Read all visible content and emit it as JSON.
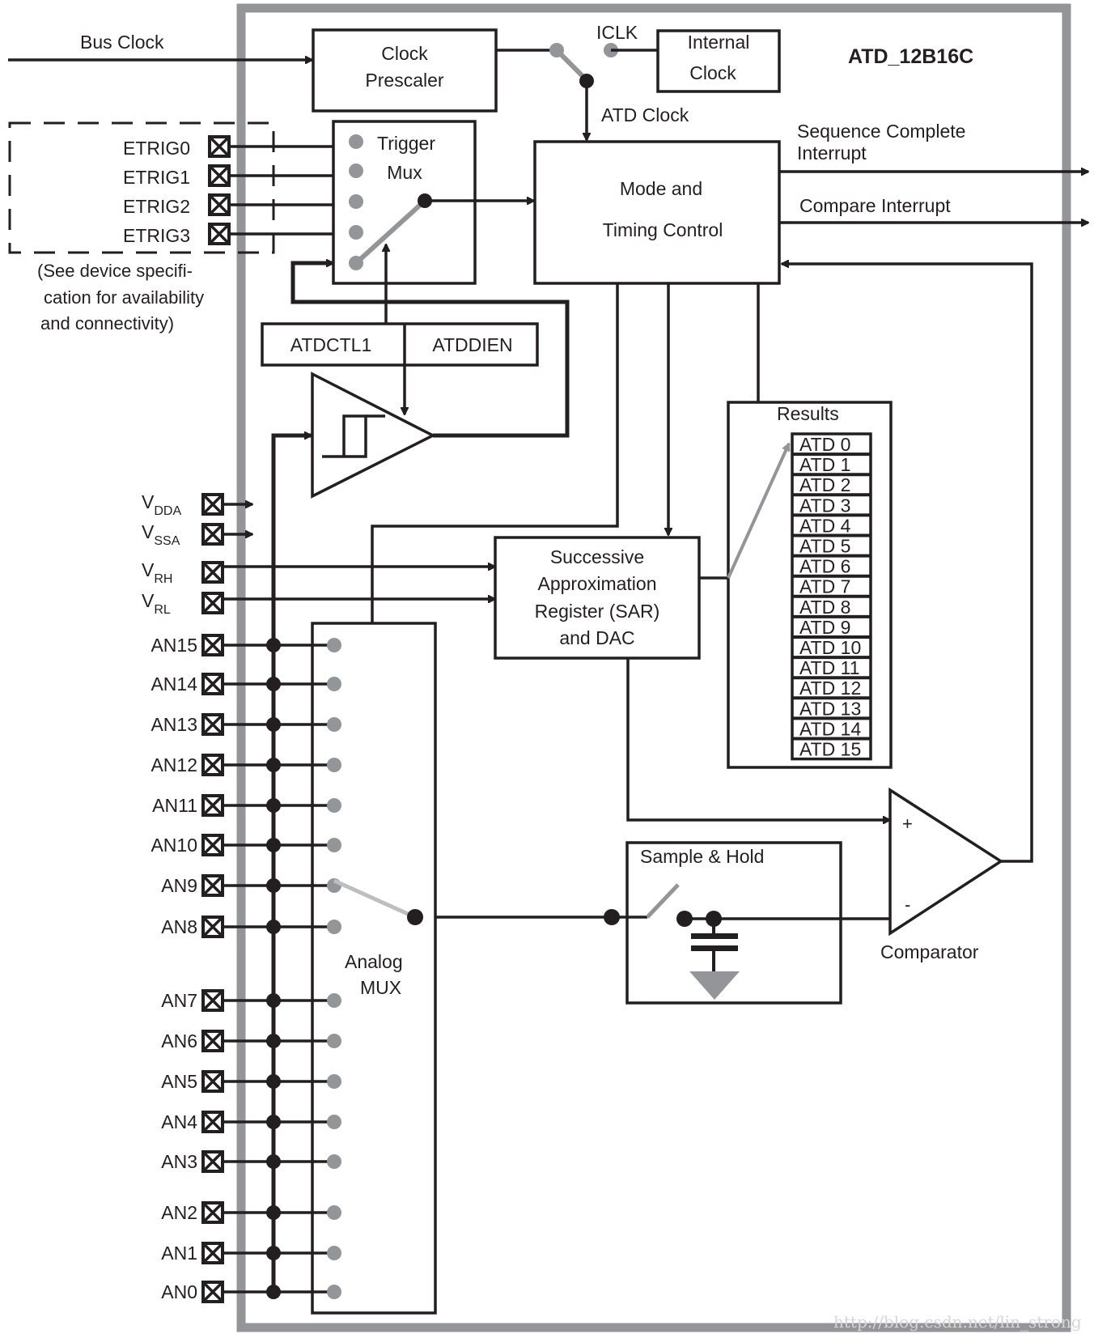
{
  "title": "ATD_12B16C",
  "external_inputs": {
    "bus_clock": "Bus Clock",
    "etrig": [
      "ETRIG0",
      "ETRIG1",
      "ETRIG2",
      "ETRIG3"
    ],
    "etrig_note": [
      "(See device specifi-",
      "cation for availability",
      "and connectivity)"
    ]
  },
  "blocks": {
    "clock_prescaler": [
      "Clock",
      "Prescaler"
    ],
    "iclk": "ICLK",
    "internal_clock": [
      "Internal",
      "Clock"
    ],
    "atd_clock": "ATD Clock",
    "trigger_mux": [
      "Trigger",
      "Mux"
    ],
    "mode_timing": [
      "Mode and",
      "Timing Control"
    ],
    "registers": [
      "ATDCTL1",
      "ATDDIEN"
    ],
    "sar": [
      "Successive",
      "Approximation",
      "Register (SAR)",
      "and DAC"
    ],
    "results_title": "Results",
    "sample_hold": "Sample & Hold",
    "comparator": "Comparator",
    "comparator_plus": "+",
    "comparator_minus": "-",
    "analog_mux": [
      "Analog",
      "MUX"
    ]
  },
  "outputs": {
    "seq_complete": [
      "Sequence Complete",
      "Interrupt"
    ],
    "compare_interrupt": "Compare Interrupt"
  },
  "supply_pins": [
    {
      "main": "V",
      "sub": "DDA"
    },
    {
      "main": "V",
      "sub": "SSA"
    },
    {
      "main": "V",
      "sub": "RH"
    },
    {
      "main": "V",
      "sub": "RL"
    }
  ],
  "analog_pins": [
    "AN15",
    "AN14",
    "AN13",
    "AN12",
    "AN11",
    "AN10",
    "AN9",
    "AN8",
    "AN7",
    "AN6",
    "AN5",
    "AN4",
    "AN3",
    "AN2",
    "AN1",
    "AN0"
  ],
  "results": [
    "ATD 0",
    "ATD 1",
    "ATD 2",
    "ATD 3",
    "ATD 4",
    "ATD 5",
    "ATD 6",
    "ATD 7",
    "ATD 8",
    "ATD 9",
    "ATD 10",
    "ATD 11",
    "ATD 12",
    "ATD 13",
    "ATD 14",
    "ATD 15"
  ],
  "watermark": "http://blog.csdn.net/lin_strong",
  "colors": {
    "ink": "#231f20",
    "module_border": "#939598",
    "switch_gray": "#939598",
    "watermark": "#d6d6d6"
  }
}
